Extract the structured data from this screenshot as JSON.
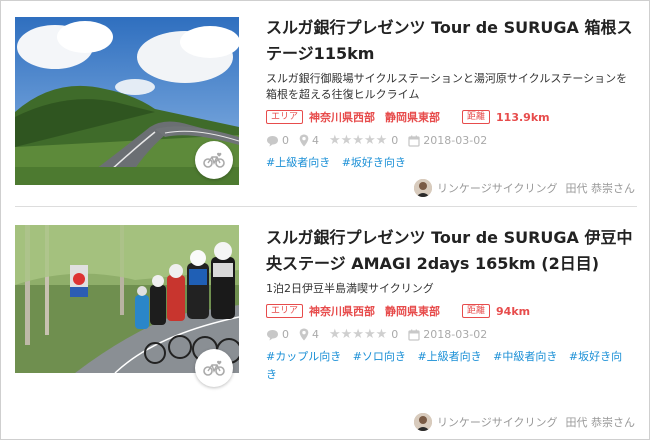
{
  "items": [
    {
      "title": "スルガ銀行プレゼンツ Tour de SURUGA 箱根ステージ115km",
      "description": "スルガ銀行御殿場サイクルステーションと湯河原サイクルステーションを箱根を超える往復ヒルクライム",
      "area_tag": "エリア",
      "areas": [
        "神奈川県西部",
        "静岡県東部"
      ],
      "distance_tag": "距離",
      "distance": "113.9km",
      "comments": "0",
      "pins": "4",
      "stars": "★★★★★",
      "rating": "0",
      "date": "2018-03-02",
      "hashtags": [
        "#上級者向き",
        "#坂好き向き"
      ],
      "author_org": "リンケージサイクリング",
      "author_name": "田代 恭崇さん"
    },
    {
      "title": "スルガ銀行プレゼンツ Tour de SURUGA 伊豆中央ステージ AMAGI 2days 165km (2日目)",
      "description": "1泊2日伊豆半島満喫サイクリング",
      "area_tag": "エリア",
      "areas": [
        "神奈川県西部",
        "静岡県東部"
      ],
      "distance_tag": "距離",
      "distance": "94km",
      "comments": "0",
      "pins": "4",
      "stars": "★★★★★",
      "rating": "0",
      "date": "2018-03-02",
      "hashtags": [
        "#カップル向き",
        "#ソロ向き",
        "#上級者向き",
        "#中級者向き",
        "#坂好き向き"
      ],
      "author_org": "リンケージサイクリング",
      "author_name": "田代 恭崇さん"
    }
  ],
  "colors": {
    "accent_red": "#e74c4c",
    "hashtag_blue": "#1a8fd6",
    "meta_gray": "#aaaaaa"
  },
  "icons": [
    "comment-icon",
    "pin-icon",
    "calendar-icon",
    "bicycle-heart-icon"
  ]
}
